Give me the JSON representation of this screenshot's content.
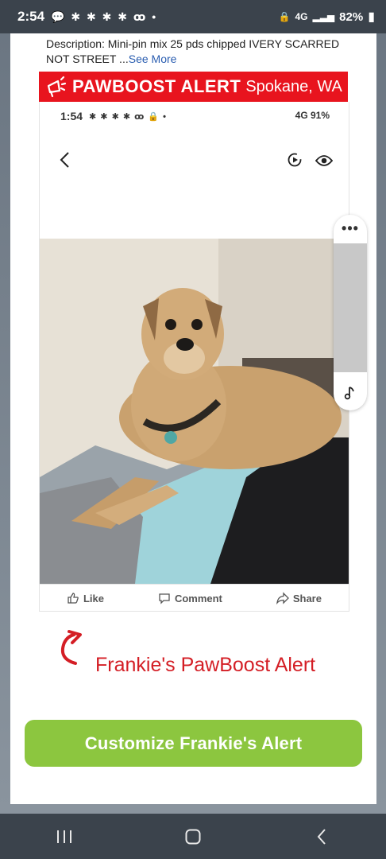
{
  "status_bar": {
    "time": "2:54",
    "icons": "💬 ✱ ✱ ✱ ✱ ꝏ •",
    "network": "4G",
    "battery": "82%"
  },
  "description": {
    "text": "Description: Mini-pin mix 25 pds chipped IVERY SCARRED NOT STREET ...",
    "see_more": "See More"
  },
  "alert_banner": {
    "brand": "PAWBOOST ALERT",
    "location": "Spokane, WA"
  },
  "embedded_screen": {
    "time": "1:54",
    "icons": "✱ ✱ ✱ ✱ ꝏ 🔒 •",
    "right_status": "4G 91%"
  },
  "post_actions": {
    "like": "Like",
    "comment": "Comment",
    "share": "Share"
  },
  "pawboost_label": "Frankie's PawBoost Alert",
  "cta_button": "Customize Frankie's Alert",
  "colors": {
    "banner_red": "#e8141e",
    "cta_green": "#8cc63f",
    "label_red": "#d41e25",
    "system_bar": "#3b434c"
  }
}
